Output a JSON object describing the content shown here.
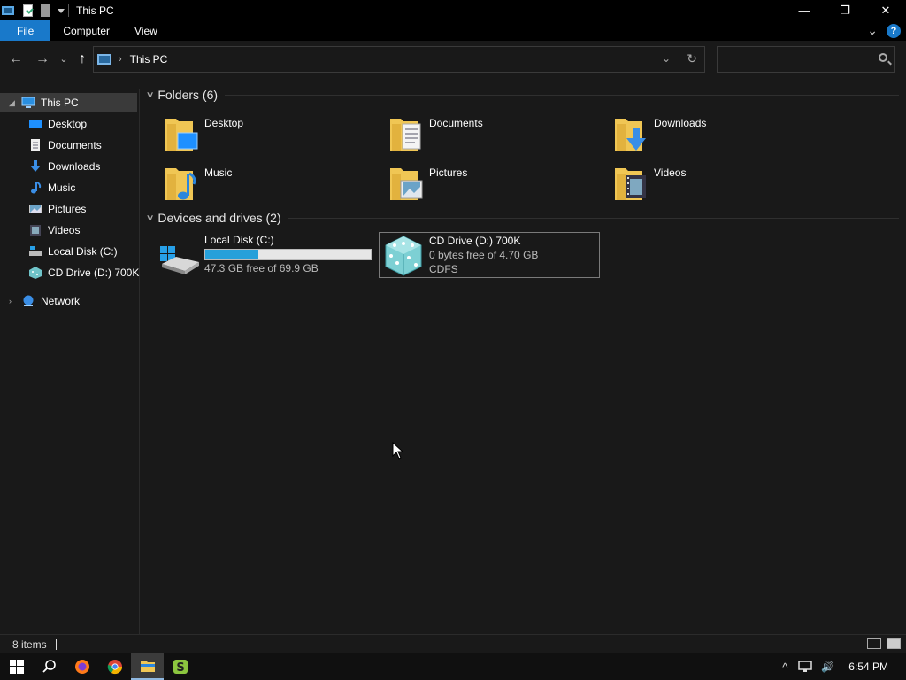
{
  "window": {
    "title": "This PC",
    "minimize_glyph": "—",
    "maximize_glyph": "❐",
    "close_glyph": "✕"
  },
  "ribbon": {
    "tabs": [
      "File",
      "Computer",
      "View"
    ],
    "expand_glyph": "⌄",
    "help_glyph": "?"
  },
  "nav": {
    "back_glyph": "←",
    "forward_glyph": "→",
    "recent_glyph": "⌄",
    "up_glyph": "↑",
    "address": "This PC",
    "address_chevron": "›",
    "dropdown_glyph": "⌄",
    "refresh_glyph": "↻",
    "search_placeholder": ""
  },
  "sidebar": {
    "items": [
      {
        "label": "This PC",
        "icon": "pc-icon"
      },
      {
        "label": "Desktop",
        "icon": "desktop-icon"
      },
      {
        "label": "Documents",
        "icon": "documents-icon"
      },
      {
        "label": "Downloads",
        "icon": "downloads-icon"
      },
      {
        "label": "Music",
        "icon": "music-icon"
      },
      {
        "label": "Pictures",
        "icon": "pictures-icon"
      },
      {
        "label": "Videos",
        "icon": "videos-icon"
      },
      {
        "label": "Local Disk (C:)",
        "icon": "disk-icon"
      },
      {
        "label": "CD Drive (D:) 700K",
        "icon": "cd-icon"
      },
      {
        "label": "Network",
        "icon": "network-icon"
      }
    ]
  },
  "folders": {
    "header": "Folders (6)",
    "items": [
      {
        "label": "Desktop",
        "icon": "desktop-folder-icon"
      },
      {
        "label": "Documents",
        "icon": "documents-folder-icon"
      },
      {
        "label": "Downloads",
        "icon": "downloads-folder-icon"
      },
      {
        "label": "Music",
        "icon": "music-folder-icon"
      },
      {
        "label": "Pictures",
        "icon": "pictures-folder-icon"
      },
      {
        "label": "Videos",
        "icon": "videos-folder-icon"
      }
    ]
  },
  "drives": {
    "header": "Devices and drives (2)",
    "items": [
      {
        "label": "Local Disk (C:)",
        "free": "47.3 GB free of 69.9 GB",
        "used_fraction": 0.323,
        "icon": "local-disk-icon"
      },
      {
        "label": "CD Drive (D:) 700K",
        "free": "0 bytes free of 4.70 GB",
        "fs": "CDFS",
        "icon": "cd-drive-icon"
      }
    ]
  },
  "status": {
    "items_count": "8 items"
  },
  "taskbar": {
    "clock": "6:54 PM",
    "tray_up_glyph": "^",
    "speaker_glyph": "🔊"
  },
  "colors": {
    "accent": "#1979ca",
    "bar_fill": "#26a0da",
    "background": "#191919"
  }
}
